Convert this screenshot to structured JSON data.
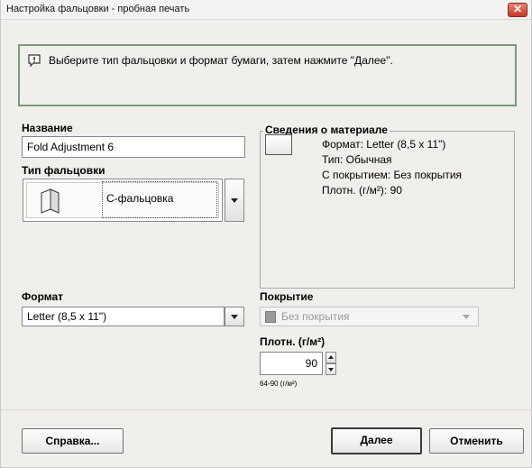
{
  "window": {
    "title": "Настройка фальцовки - пробная печать",
    "close_icon": "close-icon"
  },
  "info": {
    "icon": "speech-bubble-icon",
    "text": "Выберите тип фальцовки и формат бумаги, затем нажмите \"Далее\"."
  },
  "name": {
    "label": "Название",
    "value": "Fold Adjustment 6"
  },
  "fold_type": {
    "label": "Тип фальцовки",
    "selected": "С-фальцовка",
    "icon": "c-fold-icon"
  },
  "material_info": {
    "legend": "Сведения о материале",
    "icon": "paper-icon",
    "lines": [
      "Формат: Letter (8,5 x 11\")",
      "Тип:  Обычная",
      "С покрытием: Без покрытия",
      "Плотн. (г/м²): 90"
    ]
  },
  "format": {
    "label": "Формат",
    "selected": "Letter (8,5 x 11\")"
  },
  "coating": {
    "label": "Покрытие",
    "selected": "Без покрытия",
    "disabled": true
  },
  "weight": {
    "label": "Плотн. (г/м²)",
    "value": "90",
    "range": "64-90 (г/м²)"
  },
  "buttons": {
    "help": "Справка...",
    "next": "Далее",
    "cancel": "Отменить"
  },
  "colors": {
    "close": "#c2392a",
    "info_border": "#7a9a7a",
    "background": "#f0efec"
  }
}
